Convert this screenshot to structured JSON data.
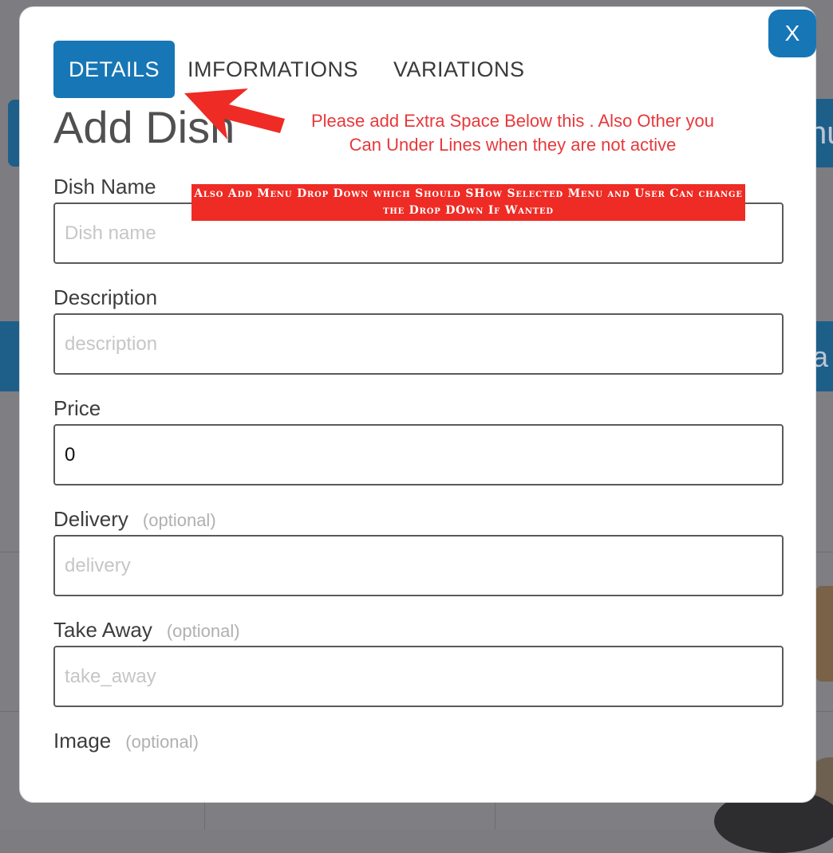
{
  "background": {
    "right_button_text": "hu",
    "bar_text": "a"
  },
  "modal": {
    "close_label": "X",
    "tabs": [
      {
        "label": "DETAILS",
        "active": true
      },
      {
        "label": "IMFORMATIONS",
        "active": false
      },
      {
        "label": "VARIATIONS",
        "active": false
      }
    ],
    "title": "Add Dish",
    "fields": [
      {
        "label": "Dish Name",
        "optional": "",
        "placeholder": "Dish name",
        "value": ""
      },
      {
        "label": "Description",
        "optional": "",
        "placeholder": "description",
        "value": ""
      },
      {
        "label": "Price",
        "optional": "",
        "placeholder": "",
        "value": "0"
      },
      {
        "label": "Delivery",
        "optional": "(optional)",
        "placeholder": "delivery",
        "value": ""
      },
      {
        "label": "Take Away",
        "optional": "(optional)",
        "placeholder": "take_away",
        "value": ""
      },
      {
        "label": "Image",
        "optional": "(optional)"
      }
    ]
  },
  "annotations": {
    "arrow_note": "Please add Extra Space Below this .  Also Other you Can Under Lines when they are not active",
    "box_note": "Also Add  Menu Drop Down which Should SHow Selected Menu and User Can change the Drop DOwn If Wanted"
  },
  "colors": {
    "accent": "#1776b6",
    "annotation_red": "#ee2b24",
    "overlay": "#7d7c80"
  }
}
